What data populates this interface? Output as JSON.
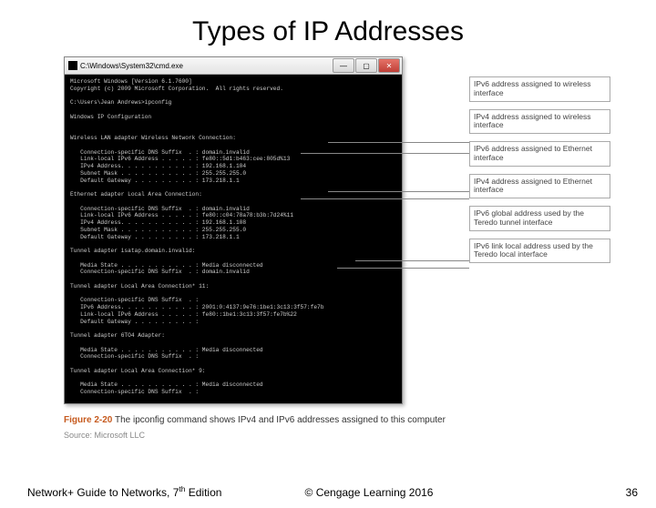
{
  "title": "Types of IP Addresses",
  "cmd": {
    "titlebar_path": "C:\\Windows\\System32\\cmd.exe",
    "body": "Microsoft Windows [Version 6.1.7600]\nCopyright (c) 2009 Microsoft Corporation.  All rights reserved.\n\nC:\\Users\\Jean Andrews>ipconfig\n\nWindows IP Configuration\n\n\nWireless LAN adapter Wireless Network Connection:\n\n   Connection-specific DNS Suffix  . : domain.invalid\n   Link-local IPv6 Address . . . . . : fe80::5d1:b463:cee:805d%13\n   IPv4 Address. . . . . . . . . . . : 192.168.1.104\n   Subnet Mask . . . . . . . . . . . : 255.255.255.0\n   Default Gateway . . . . . . . . . : 173.218.1.1\n\nEthernet adapter Local Area Connection:\n\n   Connection-specific DNS Suffix  . : domain.invalid\n   Link-local IPv6 Address . . . . . : fe80::c04:78a78:b3b:7d24%11\n   IPv4 Address. . . . . . . . . . . : 192.168.1.108\n   Subnet Mask . . . . . . . . . . . : 255.255.255.0\n   Default Gateway . . . . . . . . . : 173.218.1.1\n\nTunnel adapter isatap.domain.invalid:\n\n   Media State . . . . . . . . . . . : Media disconnected\n   Connection-specific DNS Suffix  . : domain.invalid\n\nTunnel adapter Local Area Connection* 11:\n\n   Connection-specific DNS Suffix  . :\n   IPv6 Address. . . . . . . . . . . : 2001:0:4137:9e76:1be1:3c13:3f57:fe7b\n   Link-local IPv6 Address . . . . . : fe80::1be1:3c13:3f57:fe7b%22\n   Default Gateway . . . . . . . . . :\n\nTunnel adapter 6TO4 Adapter:\n\n   Media State . . . . . . . . . . . : Media disconnected\n   Connection-specific DNS Suffix  . :\n\nTunnel adapter Local Area Connection* 9:\n\n   Media State . . . . . . . . . . . : Media disconnected\n   Connection-specific DNS Suffix  . :"
  },
  "labels": {
    "l1": "IPv6 address assigned to wireless interface",
    "l2": "IPv4 address assigned to wireless interface",
    "l3": "IPv6 address assigned to Ethernet interface",
    "l4": "IPv4 address assigned to Ethernet interface",
    "l5": "IPv6 global address used by the Teredo tunnel interface",
    "l6": "IPv6 link local address used by the Teredo local interface"
  },
  "caption": {
    "fignum": "Figure 2-20",
    "text": "The ipconfig command shows IPv4 and IPv6 addresses assigned to this computer",
    "source": "Source: Microsoft LLC"
  },
  "footer": {
    "left_a": "Network+ Guide to Networks, 7",
    "left_sup": "th",
    "left_b": " Edition",
    "center": "© Cengage Learning  2016",
    "right": "36"
  },
  "btn": {
    "min": "—",
    "max": "▢",
    "close": "✕"
  }
}
